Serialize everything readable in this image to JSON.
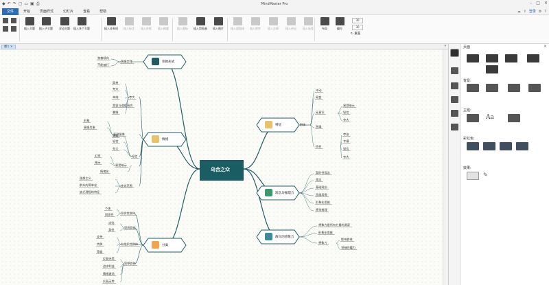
{
  "window": {
    "title": "MindMaster Pro"
  },
  "menu": {
    "items": [
      "文件",
      "开始",
      "页面样式",
      "幻灯片",
      "查看",
      "帮助"
    ],
    "login": "登录"
  },
  "ribbon": {
    "buttons": [
      {
        "label": "插入主题",
        "disabled": false
      },
      {
        "label": "插入子主题",
        "disabled": false
      },
      {
        "label": "浮动主题",
        "disabled": false
      },
      {
        "label": "插入多个主题",
        "disabled": false
      },
      {
        "label": "插入关系线",
        "disabled": false
      },
      {
        "label": "插入标注",
        "disabled": true
      },
      {
        "label": "插入外框",
        "disabled": true
      },
      {
        "label": "插入概要",
        "disabled": true
      },
      {
        "label": "插入图标",
        "disabled": true
      },
      {
        "label": "插入剪贴画",
        "disabled": false
      },
      {
        "label": "插入图片",
        "disabled": false
      },
      {
        "label": "插入超链接",
        "disabled": true
      },
      {
        "label": "插入附件",
        "disabled": true
      },
      {
        "label": "插入注释",
        "disabled": true
      },
      {
        "label": "插入评论",
        "disabled": true
      },
      {
        "label": "插入标签",
        "disabled": true
      },
      {
        "label": "布局",
        "disabled": false
      },
      {
        "label": "编号",
        "disabled": false
      }
    ],
    "spin1": "30",
    "spin2": "30",
    "reset": "重置"
  },
  "tab": {
    "doc_name": "新1"
  },
  "panel": {
    "title": "页面",
    "background_label": "背景:",
    "theme_label": "主题:",
    "color_label": "彩虹色:",
    "effect_label": "效果:"
  },
  "mindmap": {
    "central": "乌合之众",
    "main": [
      {
        "label": "宗教形式",
        "icon": "cross-icon"
      },
      {
        "label": "情绪",
        "icon": "hands-icon"
      },
      {
        "label": "分类",
        "icon": "calendar-icon"
      },
      {
        "label": "特征",
        "icon": "eye-icon"
      },
      {
        "label": "观念与推理力",
        "icon": "network-icon"
      },
      {
        "label": "群众的想象力",
        "icon": "head-icon"
      }
    ],
    "text": {
      "religion_sub": "偶像崇拜",
      "religion_leaf1": "独裁倾向",
      "religion_leaf2": "不能被打",
      "emo_a_list": [
        "简单",
        "夸大",
        "单纯",
        "宽容与道德高尚",
        "暴躁",
        "善变",
        "易受暗示"
      ],
      "emo_a_label": "夸大",
      "emo_b_label": "直观图像",
      "emo_b_leaf": "易受暗示",
      "emo_b_list": [
        "形象",
        "感情用事"
      ],
      "emo_c_list": [
        "想象",
        "轻信",
        "夸大"
      ],
      "emo_c_label": "轻信",
      "emo_d_list": [
        "幻觉",
        "暗示"
      ],
      "emo_d_label": "易受暗示",
      "emo_e_label": "情绪化",
      "emo_e_list": [
        "理想化",
        "迷信"
      ],
      "emo_e_list2": [
        "易轻信",
        "善变"
      ],
      "emo_f_label": "变化范围",
      "emo_f_list": [
        "理想主义",
        "群众的简单化",
        "缺乏理智的特征"
      ],
      "cls_a_label": "异质性群体",
      "cls_a_list": [
        "个体",
        "同质性"
      ],
      "cls_b_label": "同质群体",
      "cls_b_list": [
        "派别",
        "身份",
        "阶层"
      ],
      "cls_c_label": "有组织性群体",
      "cls_c_list": [
        "支持",
        "特殊",
        "等级",
        "标准"
      ],
      "cls_d_label": "犯罪群体",
      "cls_d_list": [
        "反复无常",
        "追求利益",
        "情绪激动"
      ],
      "char_top": [
        "冲动",
        "易变",
        "急躁"
      ],
      "char_mid_label": "无意识",
      "char_mid_list": [
        "易受暗示",
        "轻信",
        "夸大"
      ],
      "char_label": "特性",
      "char_bottom": [
        "夸张",
        "专横"
      ],
      "char_row_label": "群体",
      "ideas_list": [
        "暂时性观念",
        "观念",
        "基础观念",
        "思维局限",
        "形象化思维",
        "感觉推理"
      ],
      "imag_list": [
        "想象力是所有力量的源泉",
        "形象化思维"
      ],
      "imag_mid": "想象力",
      "imag_sub": [
        "影响群体",
        "领袖的魔力"
      ]
    }
  }
}
